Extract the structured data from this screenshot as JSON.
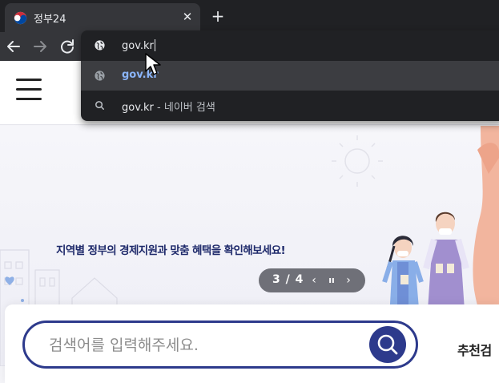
{
  "browser": {
    "tab": {
      "title": "정부24",
      "close_glyph": "✕",
      "favicon": "taegeuk-icon"
    },
    "new_tab_glyph": "+",
    "nav": {
      "back": "arrow-left-icon",
      "forward": "arrow-right-icon",
      "reload": "reload-icon"
    },
    "omnibox": {
      "typed_text": "gov.kr",
      "suggestions": [
        {
          "icon": "globe-icon",
          "text": "gov.kr",
          "suffix": ""
        },
        {
          "icon": "search-icon",
          "text": "gov.kr",
          "suffix": "- 네이버 검색"
        }
      ]
    }
  },
  "page": {
    "banner": {
      "headline": "지역별 정부의 경제지원과 맞춤 혜택을 확인해보세요!",
      "slider": {
        "count": "3 / 4",
        "prev": "‹",
        "pause": "ıı",
        "next": "›"
      }
    },
    "search": {
      "placeholder": "검색어를 입력해주세요.",
      "recommend_label": "추천검"
    }
  },
  "colors": {
    "browser_dark": "#202124",
    "toolbar": "#35363a",
    "link_blue": "#8ab4f8",
    "brand_navy": "#2d3a8c",
    "slider_gray": "#6f7078"
  }
}
